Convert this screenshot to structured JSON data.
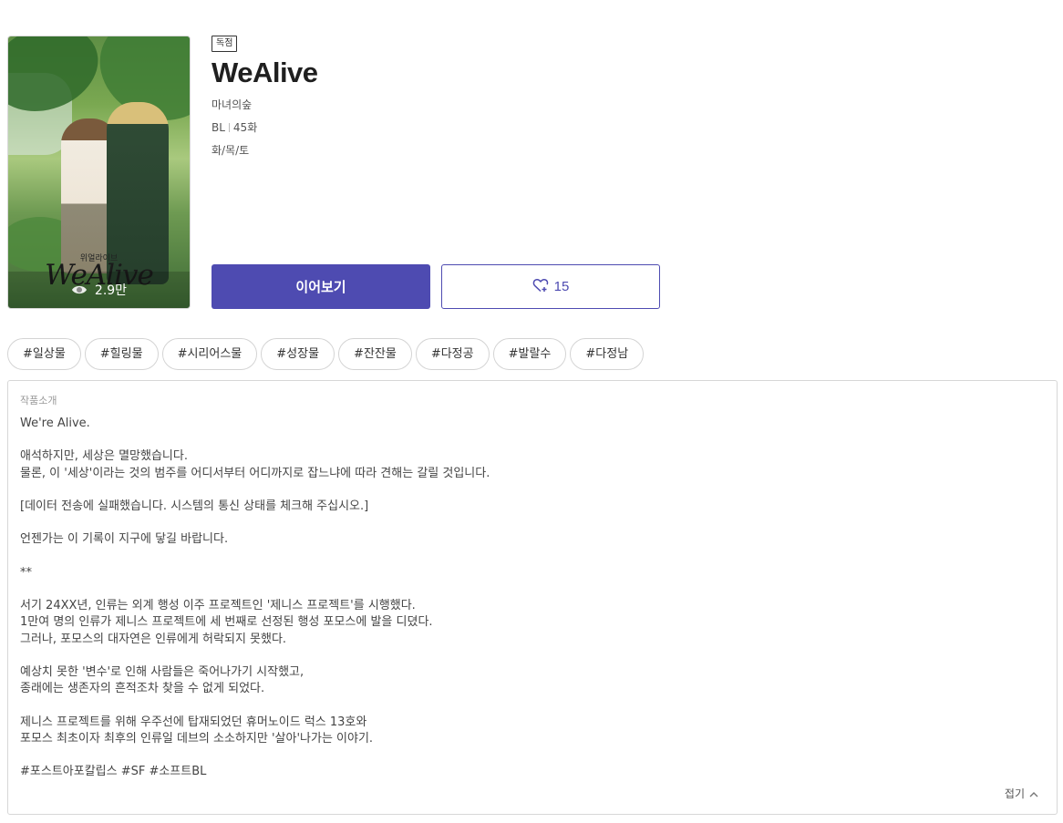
{
  "series": {
    "badge": "독점",
    "title": "WeAlive",
    "author": "마녀의숲",
    "genre": "BL",
    "episodes": "45화",
    "days": "화/목/토",
    "views": "2.9만",
    "cover_art_title": "WeAlive",
    "cover_art_subtitle": "위얼라이브"
  },
  "actions": {
    "continue_label": "이어보기",
    "like_count": "15"
  },
  "tags": [
    "#일상물",
    "#힐링물",
    "#시리어스물",
    "#성장물",
    "#잔잔물",
    "#다정공",
    "#발랄수",
    "#다정남"
  ],
  "synopsis": {
    "heading": "작품소개",
    "lines": [
      "We're Alive.",
      "",
      "애석하지만, 세상은 멸망했습니다.",
      "물론, 이 '세상'이라는 것의 범주를 어디서부터 어디까지로 잡느냐에 따라 견해는 갈릴 것입니다.",
      "",
      "[데이터 전송에 실패했습니다. 시스템의 통신 상태를 체크해 주십시오.]",
      "",
      "언젠가는 이 기록이 지구에 닿길 바랍니다.",
      "",
      "**",
      "",
      "서기 24XX년, 인류는 외계 행성 이주 프로젝트인 '제니스 프로젝트'를 시행했다.",
      "1만여 명의 인류가 제니스 프로젝트에 세 번째로 선정된 행성 포모스에 발을 디뎠다.",
      "그러나, 포모스의 대자연은 인류에게 허락되지 못했다.",
      "",
      "예상치 못한 '변수'로 인해 사람들은 죽어나가기 시작했고,",
      "종래에는 생존자의 흔적조차 찾을 수 없게 되었다.",
      "",
      "제니스 프로젝트를 위해 우주선에 탑재되었던 휴머노이드 럭스 13호와",
      "포모스 최초이자 최후의 인류일 데브의 소소하지만 '살아'나가는 이야기.",
      "",
      "#포스트아포칼립스 #SF #소프트BL"
    ],
    "fold_label": "접기"
  },
  "colors": {
    "accent": "#4e4bb1"
  }
}
